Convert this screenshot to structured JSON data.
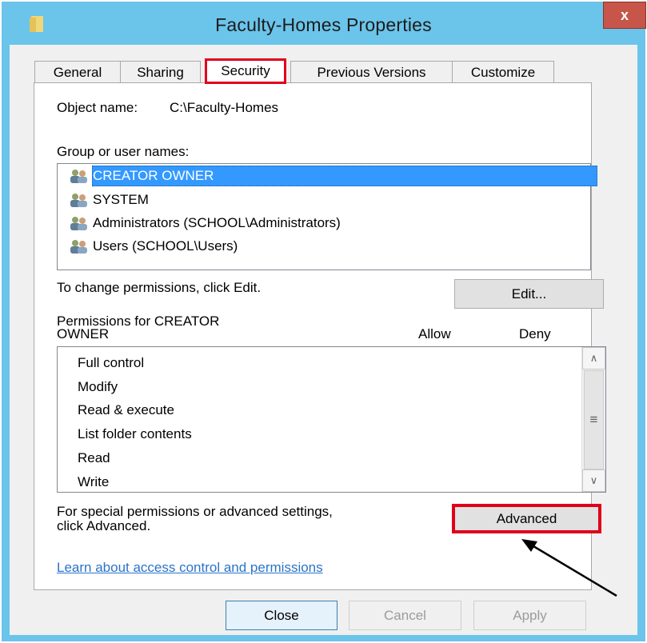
{
  "window": {
    "title": "Faculty-Homes Properties",
    "close_glyph": "x"
  },
  "tabs": [
    {
      "label": "General"
    },
    {
      "label": "Sharing"
    },
    {
      "label": "Security"
    },
    {
      "label": "Previous Versions"
    },
    {
      "label": "Customize"
    }
  ],
  "security": {
    "object_name_label": "Object name:",
    "object_name_value": "C:\\Faculty-Homes",
    "group_label": "Group or user names:",
    "users": [
      {
        "name": "CREATOR OWNER",
        "icon": "users-icon"
      },
      {
        "name": "SYSTEM",
        "icon": "users-icon"
      },
      {
        "name": "Administrators (SCHOOL\\Administrators)",
        "icon": "users-icon"
      },
      {
        "name": "Users (SCHOOL\\Users)",
        "icon": "users-icon"
      }
    ],
    "change_text": "To change permissions, click Edit.",
    "edit_button": "Edit...",
    "permissions_label_line1": "Permissions for CREATOR",
    "permissions_label_line2": "OWNER",
    "allow_header": "Allow",
    "deny_header": "Deny",
    "permissions": [
      "Full control",
      "Modify",
      "Read & execute",
      "List folder contents",
      "Read",
      "Write"
    ],
    "special_text_line1": "For special permissions or advanced settings,",
    "special_text_line2": "click Advanced.",
    "advanced_button": "Advanced",
    "learn_link": "Learn about access control and permissions"
  },
  "buttons": {
    "close": "Close",
    "cancel": "Cancel",
    "apply": "Apply"
  },
  "colors": {
    "title_bar": "#6bc4ea",
    "highlight_box": "#e0001b",
    "selection": "#3399ff",
    "link": "#2a74c9"
  }
}
